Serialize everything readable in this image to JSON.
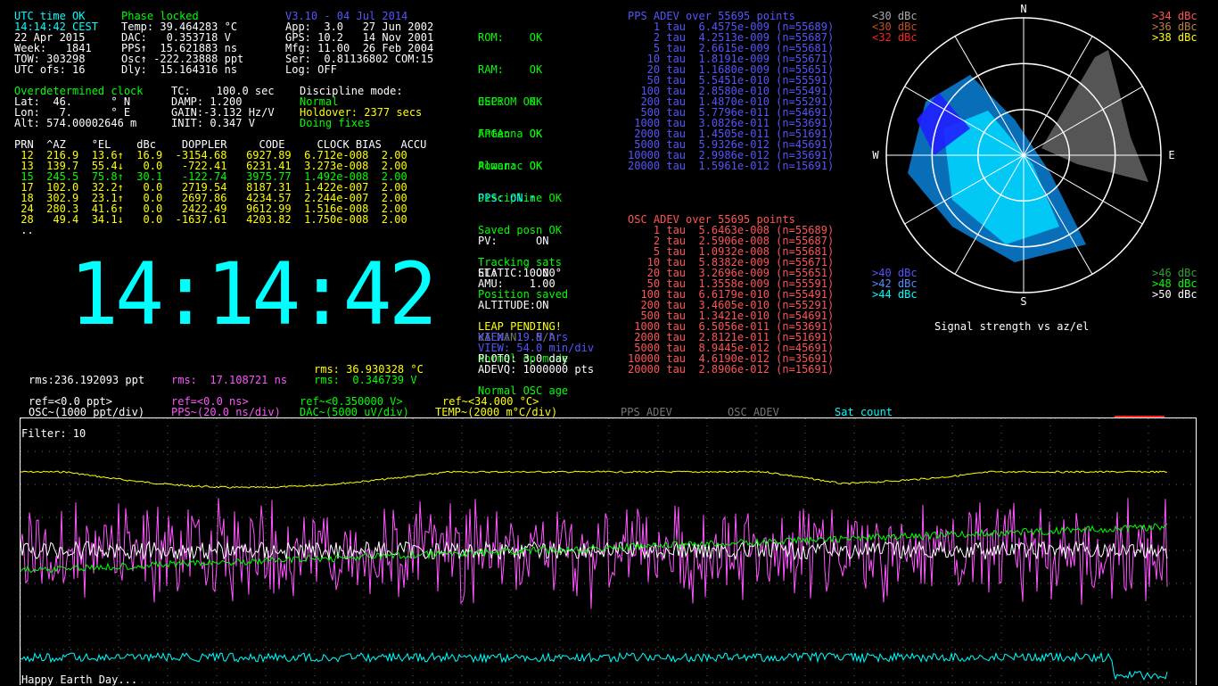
{
  "status": {
    "utc": "UTC time OK",
    "phase": "Phase locked",
    "time": "14:14:42 CEST",
    "date": "22 Apr 2015",
    "week": "Week:   1841",
    "tow": "TOW: 303298",
    "utc_ofs": "UTC ofs: 16",
    "temp": "Temp: 39.464283 °C",
    "dac": "DAC:   0.353718 V",
    "pps": "PPS↑  15.621883 ns",
    "osc": "Osc↑ -222.23888 ppt",
    "dly": "Dly:  15.164316 ns",
    "version": "V3.10 - 04 Jul 2014",
    "app": "App:  3.0   27 Jun 2002",
    "gps": "GPS: 10.2   14 Nov 2001",
    "mfg": "Mfg: 11.00  26 Feb 2004",
    "ser": "Ser:  0.81136802 COM:15",
    "log": "Log: OFF"
  },
  "health": [
    "ROM:    OK",
    "RAM:    OK",
    "OSC:    OK",
    "FPGA:   OK",
    "Power:  OK"
  ],
  "health2": [
    "EEPROM OK",
    "Antenna OK",
    "Almanac OK",
    "Discipline OK",
    "Saved posn OK",
    "Tracking sats",
    "Position saved"
  ],
  "leap": "LEAP PENDING!",
  "health3": [
    "Normal op mode",
    "Normal OSC age"
  ],
  "pps_state": "PPS: ON ↑",
  "flags": {
    "pv": "PV:      ON",
    "static": "STATIC:  ON",
    "altitude": "ALTITUDE:ON",
    "kalman": "KALMAN:  N/A",
    "el": "EL:    10.00°",
    "amu": "AMU:    1.00"
  },
  "view": {
    "hrs": "VIEW: 19.8 hrs",
    "min": "VIEW: 54.0 min/div",
    "plotq": "PLOTQ: 3.0 day",
    "adevq": "ADEVQ: 1000000 pts"
  },
  "clock": {
    "title": "Overdetermined clock",
    "lat": "Lat:  46.      ° N",
    "lon": "Lon:   7.      ° E",
    "alt": "Alt: 574.00002646 m",
    "tc": "TC:    100.0 sec",
    "damp": "DAMP: 1.200",
    "gain": "GAIN:-3.132 Hz/V",
    "init": "INIT: 0.347 V",
    "disc_title": "Discipline mode:",
    "disc_mode": "Normal",
    "holdover": "Holdover: 2377 secs",
    "fixes": "Doing fixes"
  },
  "sat_table": {
    "header": "PRN  ^AZ    °EL    dBc    DOPPLER     CODE     CLOCK BIAS   ACCU",
    "rows": [
      {
        "text": " 12  216.9  13.6↑  16.9  -3154.68   6927.89  6.712e-008  2.00",
        "color": "#ffff00"
      },
      {
        "text": " 13  139.7  55.4↓   0.0   -722.41   6231.41  3.273e-008  2.00",
        "color": "#ffff00"
      },
      {
        "text": " 15  245.5  75.8↑  30.1   -122.74   3975.77  1.492e-008  2.00",
        "color": "#00ff00"
      },
      {
        "text": " 17  102.0  32.2↑   0.0   2719.54   8187.31  1.422e-007  2.00",
        "color": "#ffff00"
      },
      {
        "text": " 18  302.9  23.1↑   0.0   2697.86   4234.57  2.244e-007  2.00",
        "color": "#ffff00"
      },
      {
        "text": " 24  280.3  41.6↑   0.0   2422.49   9612.99  1.516e-008  2.00",
        "color": "#ffff00"
      },
      {
        "text": " 28   49.4  34.1↓   0.0  -1637.61   4203.82  1.750e-008  2.00",
        "color": "#ffff00"
      }
    ],
    "ellipsis": " .."
  },
  "big_time": "14:14:42",
  "pps_adev": {
    "title": "PPS ADEV over 55695 points",
    "rows": [
      "    1 tau  6.4575e-009 (n=55689)",
      "    2 tau  4.2513e-009 (n=55687)",
      "    5 tau  2.6615e-009 (n=55681)",
      "   10 tau  1.8191e-009 (n=55671)",
      "   20 tau  1.1680e-009 (n=55651)",
      "   50 tau  5.5451e-010 (n=55591)",
      "  100 tau  2.8580e-010 (n=55491)",
      "  200 tau  1.4870e-010 (n=55291)",
      "  500 tau  5.7796e-011 (n=54691)",
      " 1000 tau  3.0826e-011 (n=53691)",
      " 2000 tau  1.4505e-011 (n=51691)",
      " 5000 tau  5.9326e-012 (n=45691)",
      "10000 tau  2.9986e-012 (n=35691)",
      "20000 tau  1.5961e-012 (n=15691)"
    ]
  },
  "osc_adev": {
    "title": "OSC ADEV over 55695 points",
    "rows": [
      "    1 tau  5.6463e-008 (n=55689)",
      "    2 tau  2.5906e-008 (n=55687)",
      "    5 tau  1.0932e-008 (n=55681)",
      "   10 tau  5.8382e-009 (n=55671)",
      "   20 tau  3.2696e-009 (n=55651)",
      "   50 tau  1.3558e-009 (n=55591)",
      "  100 tau  6.6179e-010 (n=55491)",
      "  200 tau  3.4605e-010 (n=55291)",
      "  500 tau  1.3421e-010 (n=54691)",
      " 1000 tau  6.5056e-011 (n=53691)",
      " 2000 tau  2.8121e-011 (n=51691)",
      " 5000 tau  8.9445e-012 (n=45691)",
      "10000 tau  4.6190e-012 (n=35691)",
      "20000 tau  2.8906e-012 (n=15691)"
    ]
  },
  "skymap": {
    "legend_tl": [
      "<30 dBc",
      "<30 dBc",
      "<32 dBc"
    ],
    "legend_tr": [
      ">34 dBc",
      ">36 dBc",
      ">38 dBc"
    ],
    "legend_bl": [
      ">40 dBc",
      ">42 dBc",
      ">44 dBc"
    ],
    "legend_br": [
      ">46 dBc",
      ">48 dBc",
      ">50 dBc"
    ],
    "n": "N",
    "s": "S",
    "e": "E",
    "w": "W",
    "caption": "Signal strength vs az/el"
  },
  "rms": {
    "temp": "rms: 36.930328 °C",
    "dac": "rms:  0.346739 V",
    "osc": "rms:236.192093 ppt",
    "pps": "rms:  17.108721 ns"
  },
  "scales": {
    "ref_osc": "ref=<0.0 ppt>",
    "osc_div": "OSC~(1000 ppt/div)",
    "ref_pps": "ref=<0.0 ns>",
    "pps_div": "PPS~(20.0 ns/div)",
    "ref_dac": "ref~<0.350000 V>",
    "dac_div": "DAC~(5000 uV/div)",
    "ref_temp": "ref~<34.000 °C>",
    "temp_div": "TEMP~(2000 m°C/div)",
    "pps_adev": "PPS ADEV",
    "osc_adev": "OSC ADEV",
    "sat_count": "Sat count"
  },
  "plot": {
    "filter": "Filter: 10",
    "footer": "Happy Earth Day..."
  },
  "colors": {
    "cyan": "#00ffff",
    "green": "#00ff00",
    "yellow": "#ffff00",
    "magenta": "#ff55ff",
    "blue": "#5555ff",
    "red": "#ff5555",
    "white": "#ffffff"
  }
}
